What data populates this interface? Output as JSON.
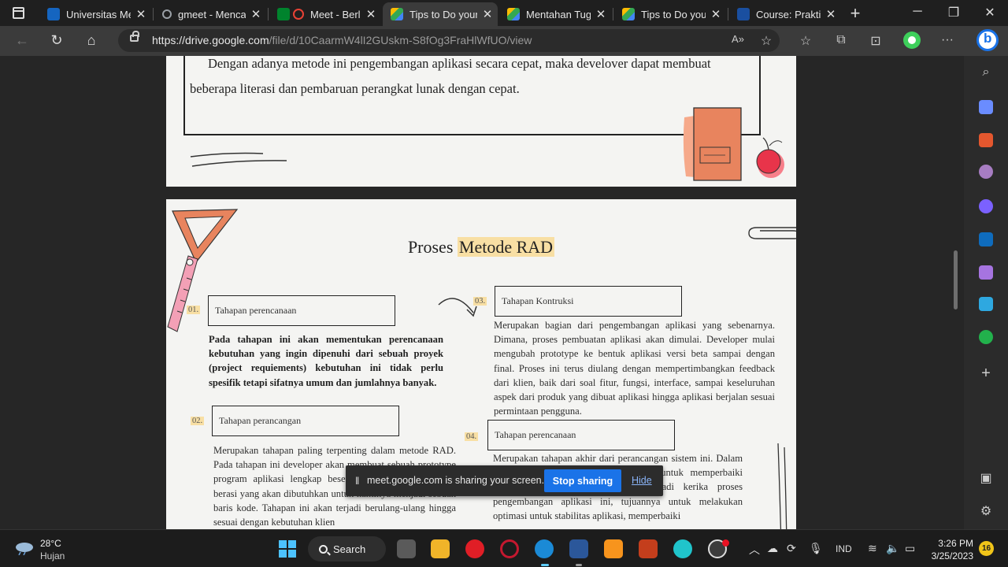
{
  "browser": {
    "tabs": [
      {
        "label": "Universitas Mercu",
        "favicon_color": "#1565c0",
        "active": false
      },
      {
        "label": "gmeet - Mencari",
        "favicon_color": "#5f6368",
        "active": false
      },
      {
        "label": "Meet - Berlangs",
        "favicon_color": "#e94235",
        "active": false
      },
      {
        "label": "Tips to Do your",
        "favicon_color": "#34a853",
        "active": true
      },
      {
        "label": "Mentahan Tugas",
        "favicon_color": "#34a853",
        "active": false
      },
      {
        "label": "Tips to Do your",
        "favicon_color": "#34a853",
        "active": false
      },
      {
        "label": "Course: Praktikum",
        "favicon_color": "#1a4fa0",
        "active": false
      }
    ],
    "close_glyph": "✕",
    "new_tab_glyph": "+",
    "url_host": "https://drive.google.com",
    "url_path": "/file/d/10CaarmW4lI2GUskm-S8fOg3FraHlWfUO/view"
  },
  "document": {
    "page1": {
      "line1": "Dengan  adanya metode ini pengembangan aplikasi secara cepat, maka develover dapat membuat",
      "line2": "beberapa literasi dan pembaruan perangkat lunak dengan cepat."
    },
    "page2": {
      "title_plain": "Proses",
      "title_highlight": "Metode RAD",
      "steps": [
        {
          "number": "01.",
          "label": "Tahapan perencanaan",
          "text": "Pada tahapan  ini akan mementukan perencanaan kebutuhan yang ingin dipenuhi dari sebuah proyek (project requiements) kebutuhan ini tidak perlu spesifik tetapi sifatnya umum dan jumlahnya banyak."
        },
        {
          "number": "02.",
          "label": "Tahapan perancangan",
          "text": "Merupakan tahapan paling terpenting dalam metode RAD. Pada tahapan ini developer akan membuat sebuah prototype program aplikasi lengkap beserta fitur dan fungsi yang berasi yang akan dibutuhkan untuk nantinya menjadi sebuah baris kode. Tahapan ini akan terjadi berulang-ulang hingga sesuai dengan kebutuhan klien"
        },
        {
          "number": "03.",
          "label": "Tahapan Kontruksi",
          "text": "Merupakan  bagian dari pengembangan aplikasi yang sebenarnya. Dimana, proses pembuatan aplikasi akan dimulai. Developer mulai mengubah prototype ke bentuk aplikasi versi beta sampai dengan final. Proses ini terus diulang dengan mempertimbangkan feedback dari klien, baik dari soal fitur, fungsi, interface, sampai keseluruhan aspek dari produk yang dibuat aplikasi hingga aplikasi berjalan sesuai permintaan pengguna."
        },
        {
          "number": "04.",
          "label": "Tahapan perencanaan",
          "text": "Merupakan tahapan akhir dari perancangan sistem ini. Dalam tahapan ini developer akan berfokus untuk memperbaiki kekurangan dan kesalahan yang terjadi kerika proses pengembangan aplikasi ini, tujuannya untuk melakukan optimasi untuk stabilitas aplikasi, memperbaiki"
        }
      ]
    }
  },
  "share_banner": {
    "message": "meet.google.com is sharing your screen.",
    "stop_label": "Stop sharing",
    "hide_label": "Hide"
  },
  "taskbar": {
    "temperature": "28°C",
    "condition": "Hujan",
    "search_label": "Search",
    "language": "IND",
    "time": "3:26 PM",
    "date": "3/25/2023",
    "notification_count": "16"
  }
}
